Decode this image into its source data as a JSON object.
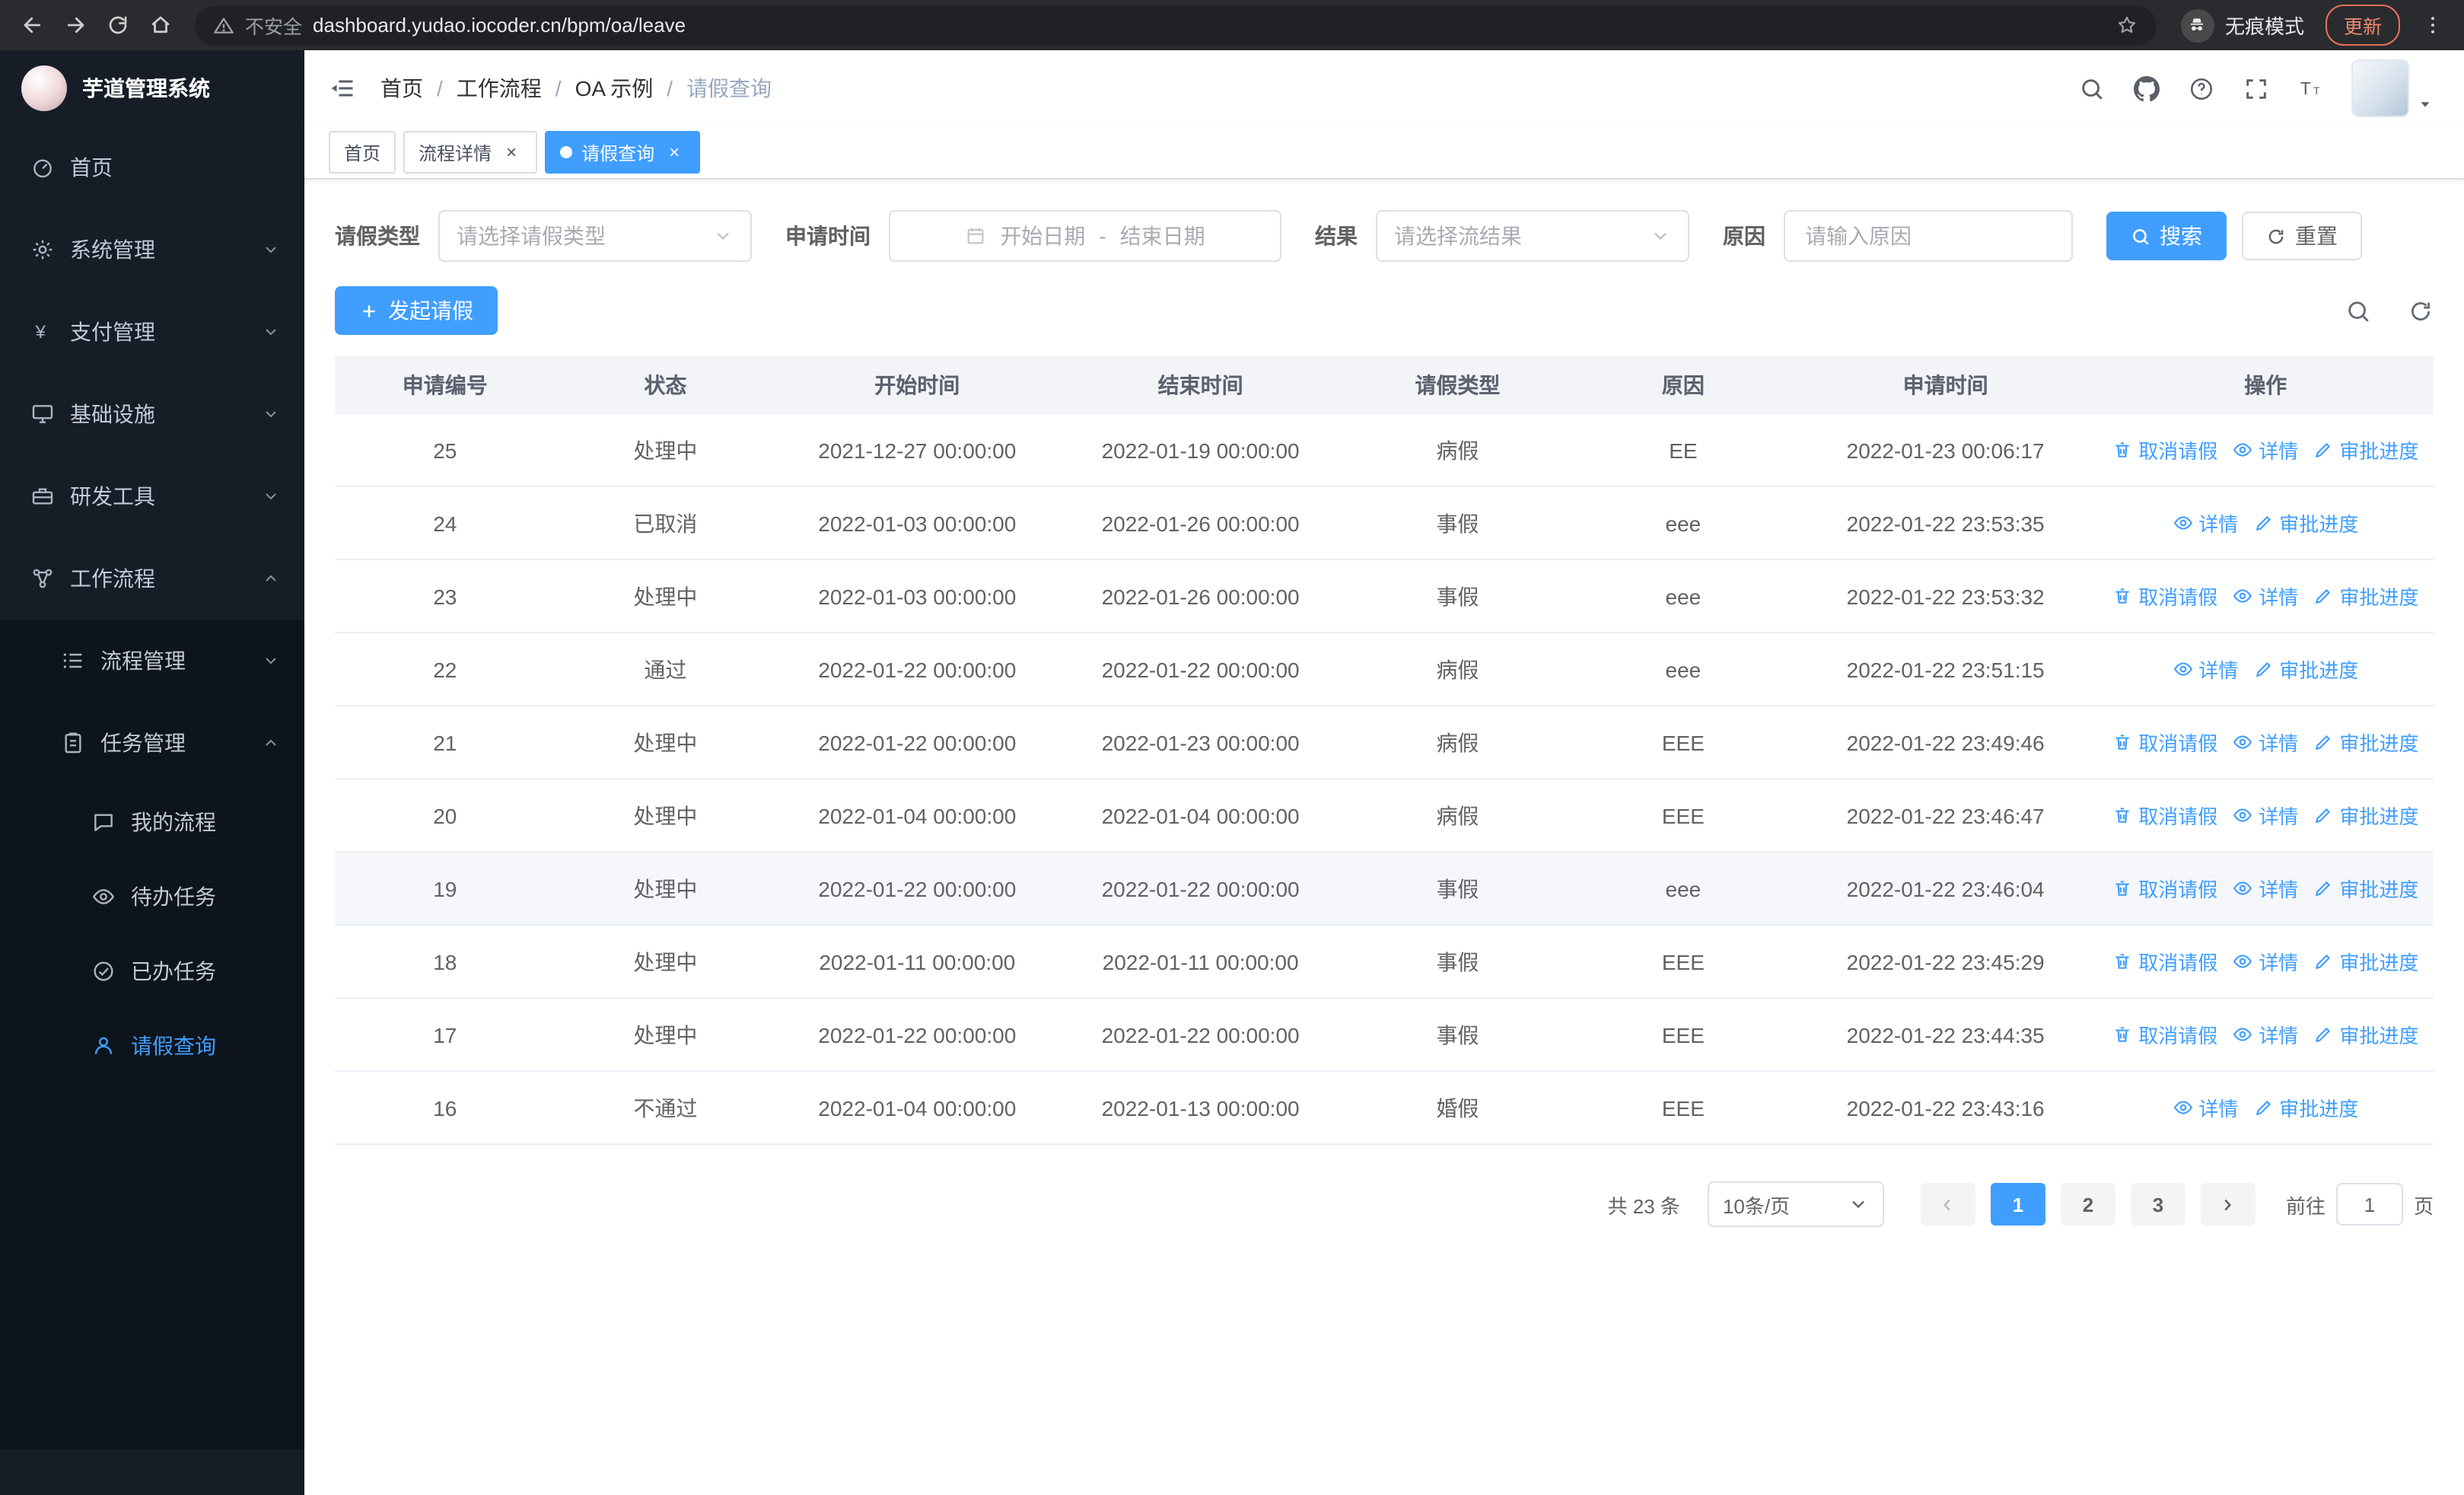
{
  "browser": {
    "security_warning": "不安全",
    "url": "dashboard.yudao.iocoder.cn/bpm/oa/leave",
    "incognito_label": "无痕模式",
    "update_label": "更新"
  },
  "sidebar": {
    "app_title": "芋道管理系统",
    "items": [
      {
        "label": "首页"
      },
      {
        "label": "系统管理"
      },
      {
        "label": "支付管理"
      },
      {
        "label": "基础设施"
      },
      {
        "label": "研发工具"
      },
      {
        "label": "工作流程"
      }
    ],
    "workflow_children": [
      {
        "label": "流程管理"
      },
      {
        "label": "任务管理"
      }
    ],
    "task_children": [
      {
        "label": "我的流程"
      },
      {
        "label": "待办任务"
      },
      {
        "label": "已办任务"
      },
      {
        "label": "请假查询"
      }
    ]
  },
  "header": {
    "breadcrumb": [
      "首页",
      "工作流程",
      "OA 示例",
      "请假查询"
    ],
    "separator": "/"
  },
  "tabs_bar": {
    "tabs": [
      {
        "label": "首页",
        "closable": false,
        "active": false
      },
      {
        "label": "流程详情",
        "closable": true,
        "active": false
      },
      {
        "label": "请假查询",
        "closable": true,
        "active": true
      }
    ]
  },
  "filters": {
    "leave_type": {
      "label": "请假类型",
      "placeholder": "请选择请假类型"
    },
    "apply_time": {
      "label": "申请时间",
      "start_placeholder": "开始日期",
      "separator": "-",
      "end_placeholder": "结束日期"
    },
    "result": {
      "label": "结果",
      "placeholder": "请选择流结果"
    },
    "reason": {
      "label": "原因",
      "placeholder": "请输入原因"
    },
    "search_button": "搜索",
    "reset_button": "重置"
  },
  "toolbar": {
    "create_button": "发起请假"
  },
  "table": {
    "columns": [
      "申请编号",
      "状态",
      "开始时间",
      "结束时间",
      "请假类型",
      "原因",
      "申请时间",
      "操作"
    ],
    "action_defs": {
      "cancel": {
        "label": "取消请假",
        "icon": "delete-icon",
        "name": "cancel-leave-action"
      },
      "detail": {
        "label": "详情",
        "icon": "view-icon",
        "name": "detail-action"
      },
      "progress": {
        "label": "审批进度",
        "icon": "edit-icon",
        "name": "approval-progress-action"
      }
    },
    "rows": [
      {
        "id": "25",
        "status": "处理中",
        "start_time": "2021-12-27 00:00:00",
        "end_time": "2022-01-19 00:00:00",
        "leave_type": "病假",
        "reason": "EE",
        "apply_time": "2022-01-23 00:06:17",
        "highlighted": false,
        "actions": [
          "cancel",
          "detail",
          "progress"
        ]
      },
      {
        "id": "24",
        "status": "已取消",
        "start_time": "2022-01-03 00:00:00",
        "end_time": "2022-01-26 00:00:00",
        "leave_type": "事假",
        "reason": "eee",
        "apply_time": "2022-01-22 23:53:35",
        "highlighted": false,
        "actions": [
          "detail",
          "progress"
        ]
      },
      {
        "id": "23",
        "status": "处理中",
        "start_time": "2022-01-03 00:00:00",
        "end_time": "2022-01-26 00:00:00",
        "leave_type": "事假",
        "reason": "eee",
        "apply_time": "2022-01-22 23:53:32",
        "highlighted": false,
        "actions": [
          "cancel",
          "detail",
          "progress"
        ]
      },
      {
        "id": "22",
        "status": "通过",
        "start_time": "2022-01-22 00:00:00",
        "end_time": "2022-01-22 00:00:00",
        "leave_type": "病假",
        "reason": "eee",
        "apply_time": "2022-01-22 23:51:15",
        "highlighted": false,
        "actions": [
          "detail",
          "progress"
        ]
      },
      {
        "id": "21",
        "status": "处理中",
        "start_time": "2022-01-22 00:00:00",
        "end_time": "2022-01-23 00:00:00",
        "leave_type": "病假",
        "reason": "EEE",
        "apply_time": "2022-01-22 23:49:46",
        "highlighted": false,
        "actions": [
          "cancel",
          "detail",
          "progress"
        ]
      },
      {
        "id": "20",
        "status": "处理中",
        "start_time": "2022-01-04 00:00:00",
        "end_time": "2022-01-04 00:00:00",
        "leave_type": "病假",
        "reason": "EEE",
        "apply_time": "2022-01-22 23:46:47",
        "highlighted": false,
        "actions": [
          "cancel",
          "detail",
          "progress"
        ]
      },
      {
        "id": "19",
        "status": "处理中",
        "start_time": "2022-01-22 00:00:00",
        "end_time": "2022-01-22 00:00:00",
        "leave_type": "事假",
        "reason": "eee",
        "apply_time": "2022-01-22 23:46:04",
        "highlighted": true,
        "actions": [
          "cancel",
          "detail",
          "progress"
        ]
      },
      {
        "id": "18",
        "status": "处理中",
        "start_time": "2022-01-11 00:00:00",
        "end_time": "2022-01-11 00:00:00",
        "leave_type": "事假",
        "reason": "EEE",
        "apply_time": "2022-01-22 23:45:29",
        "highlighted": false,
        "actions": [
          "cancel",
          "detail",
          "progress"
        ]
      },
      {
        "id": "17",
        "status": "处理中",
        "start_time": "2022-01-22 00:00:00",
        "end_time": "2022-01-22 00:00:00",
        "leave_type": "事假",
        "reason": "EEE",
        "apply_time": "2022-01-22 23:44:35",
        "highlighted": false,
        "actions": [
          "cancel",
          "detail",
          "progress"
        ]
      },
      {
        "id": "16",
        "status": "不通过",
        "start_time": "2022-01-04 00:00:00",
        "end_time": "2022-01-13 00:00:00",
        "leave_type": "婚假",
        "reason": "EEE",
        "apply_time": "2022-01-22 23:43:16",
        "highlighted": false,
        "actions": [
          "detail",
          "progress"
        ]
      }
    ]
  },
  "pagination": {
    "total": "共 23 条",
    "page_size": "10条/页",
    "pages": [
      "1",
      "2",
      "3"
    ],
    "active_page": "1",
    "goto_label": "前往",
    "goto_value": "1",
    "unit_label": "页"
  }
}
